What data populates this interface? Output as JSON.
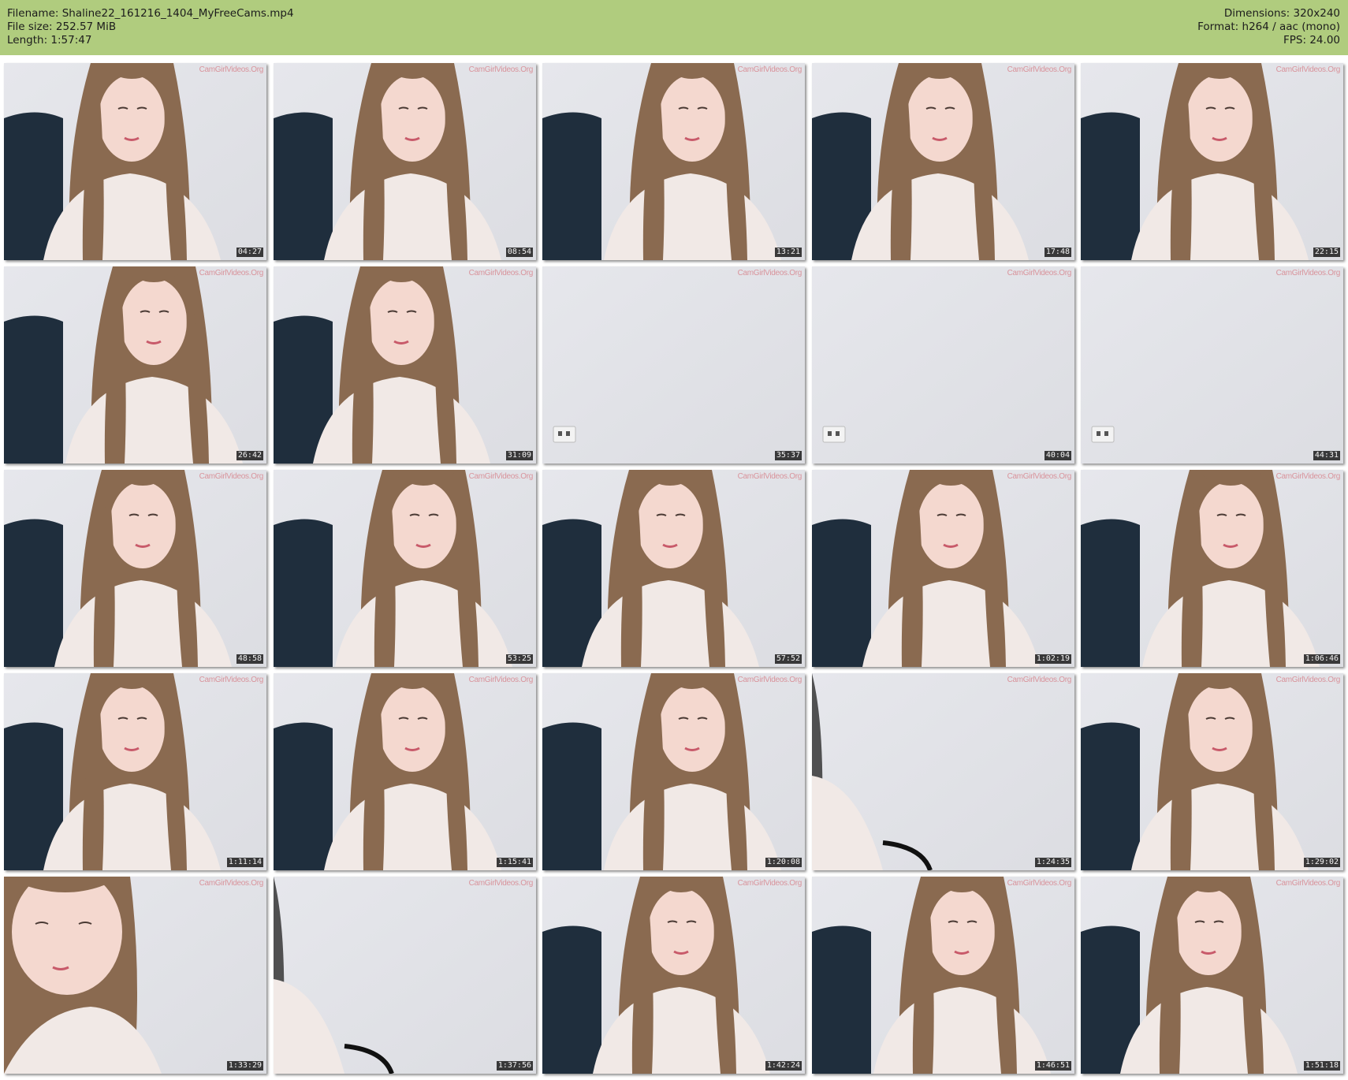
{
  "header": {
    "filename_line": "Filename: Shaline22_161216_1404_MyFreeCams.mp4",
    "filesize_line": "File size: 252.57 MiB",
    "length_line": "Length: 1:57:47",
    "dimensions_line": "Dimensions: 320x240",
    "format_line": "Format: h264 / aac (mono)",
    "fps_line": "FPS: 24.00"
  },
  "colors": {
    "header_bg": "#b0cc7e",
    "hair": "#8a6a50",
    "wall": "#dcdde2",
    "chair": "#1f2e3d",
    "blouse": "#f1e9e6",
    "skin": "#f4d8cf"
  },
  "watermark": "CamGirlVideos.Org",
  "thumbnails": [
    {
      "time": "04:27",
      "scene": "person"
    },
    {
      "time": "08:54",
      "scene": "person"
    },
    {
      "time": "13:21",
      "scene": "person"
    },
    {
      "time": "17:48",
      "scene": "person"
    },
    {
      "time": "22:15",
      "scene": "person"
    },
    {
      "time": "26:42",
      "scene": "person"
    },
    {
      "time": "31:09",
      "scene": "person"
    },
    {
      "time": "35:37",
      "scene": "empty"
    },
    {
      "time": "40:04",
      "scene": "empty"
    },
    {
      "time": "44:31",
      "scene": "empty"
    },
    {
      "time": "48:58",
      "scene": "person"
    },
    {
      "time": "53:25",
      "scene": "person"
    },
    {
      "time": "57:52",
      "scene": "person"
    },
    {
      "time": "1:02:19",
      "scene": "person"
    },
    {
      "time": "1:06:46",
      "scene": "person"
    },
    {
      "time": "1:11:14",
      "scene": "person"
    },
    {
      "time": "1:15:41",
      "scene": "person"
    },
    {
      "time": "1:20:08",
      "scene": "person"
    },
    {
      "time": "1:24:35",
      "scene": "edge"
    },
    {
      "time": "1:29:02",
      "scene": "person"
    },
    {
      "time": "1:33:29",
      "scene": "closeup"
    },
    {
      "time": "1:37:56",
      "scene": "edge"
    },
    {
      "time": "1:42:24",
      "scene": "person"
    },
    {
      "time": "1:46:51",
      "scene": "person"
    },
    {
      "time": "1:51:18",
      "scene": "person"
    }
  ]
}
